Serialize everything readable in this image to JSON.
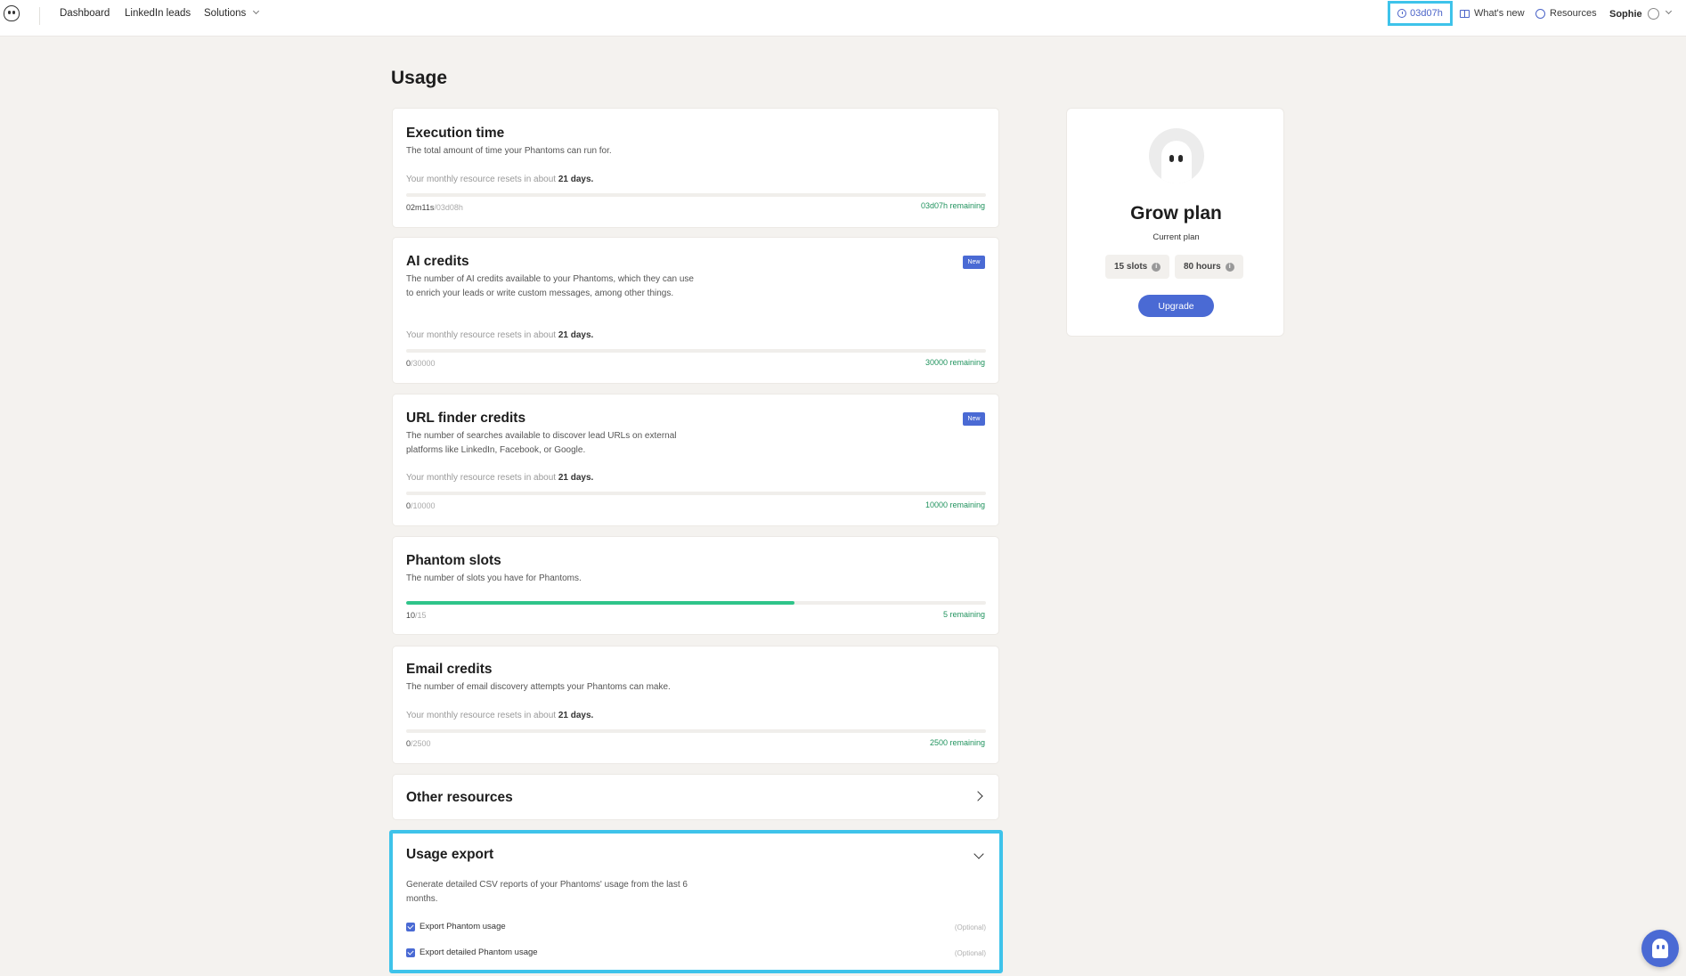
{
  "nav": {
    "dashboard": "Dashboard",
    "linkedin_leads": "LinkedIn leads",
    "solutions": "Solutions",
    "time_remaining": "03d07h",
    "whats_new": "What's new",
    "resources": "Resources",
    "user_name": "Sophie"
  },
  "page_title": "Usage",
  "cards": {
    "execution": {
      "title": "Execution time",
      "desc": "The total amount of time your Phantoms can run for.",
      "reset_prefix": "Your monthly resource resets in about",
      "reset_days": "21 days.",
      "used": "02m11s",
      "max": "/03d08h",
      "remaining": "03d07h remaining",
      "progress": 0.0
    },
    "ai_credits": {
      "title": "AI credits",
      "badge": "New",
      "desc": "The number of AI credits available to your Phantoms, which they can use to enrich your leads or write custom messages, among other things.",
      "reset_prefix": "Your monthly resource resets in about",
      "reset_days": "21 days.",
      "used": "0",
      "max": "/30000",
      "remaining": "30000 remaining",
      "progress": 0.0
    },
    "url_finder": {
      "title": "URL finder credits",
      "badge": "New",
      "desc": "The number of searches available to discover lead URLs on external platforms like LinkedIn, Facebook, or Google.",
      "reset_prefix": "Your monthly resource resets in about",
      "reset_days": "21 days.",
      "used": "0",
      "max": "/10000",
      "remaining": "10000 remaining",
      "progress": 0.0
    },
    "phantom_slots": {
      "title": "Phantom slots",
      "desc": "The number of slots you have for Phantoms.",
      "used": "10",
      "max": "/15",
      "remaining": "5 remaining",
      "progress": 0.67
    },
    "email_credits": {
      "title": "Email credits",
      "desc": "The number of email discovery attempts your Phantoms can make.",
      "reset_prefix": "Your monthly resource resets in about",
      "reset_days": "21 days.",
      "used": "0",
      "max": "/2500",
      "remaining": "2500 remaining",
      "progress": 0.0
    },
    "other_resources": {
      "title": "Other resources"
    },
    "usage_export": {
      "title": "Usage export",
      "desc": "Generate detailed CSV reports of your Phantoms' usage from the last 6 months.",
      "options": [
        {
          "label": "Export Phantom usage",
          "optional": "(Optional)",
          "checked": true
        },
        {
          "label": "Export detailed Phantom usage",
          "optional": "(Optional)",
          "checked": true
        }
      ]
    }
  },
  "plan": {
    "name": "Grow plan",
    "subtitle": "Current plan",
    "slots": "15 slots",
    "hours": "80 hours",
    "upgrade": "Upgrade"
  },
  "colors": {
    "accent": "#4a6ad4",
    "progress": "#2fc48a",
    "remaining_text": "#21935e",
    "highlight": "#3ec3ea"
  }
}
